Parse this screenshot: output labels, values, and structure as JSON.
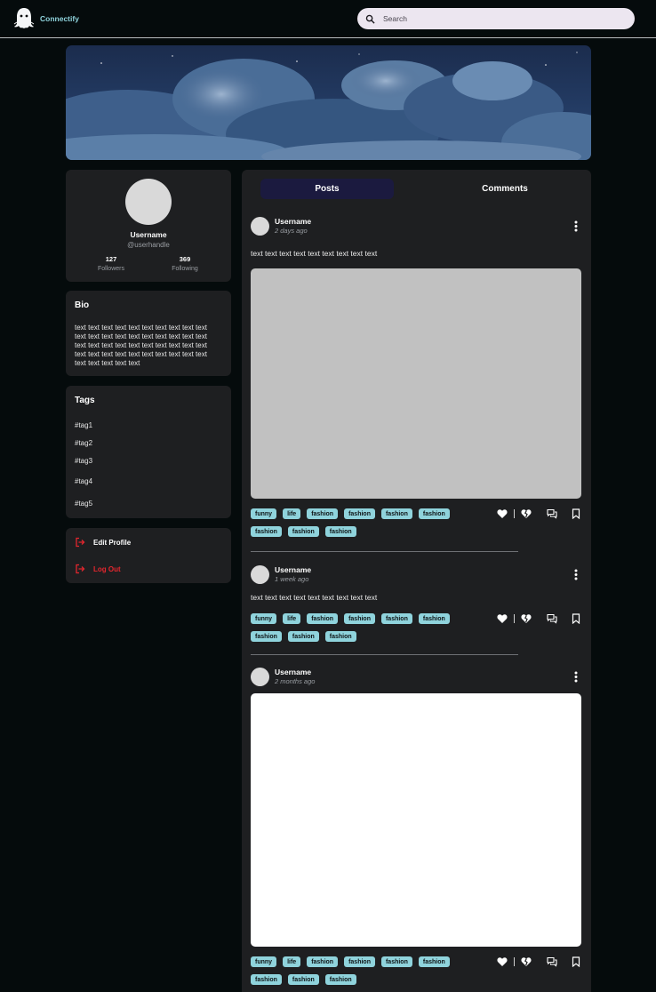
{
  "app": {
    "name": "Connectify"
  },
  "search": {
    "placeholder": "Search"
  },
  "icons": {
    "logo": "ghost-logo-icon",
    "search": "search-icon",
    "edit": "logout-arrow-icon",
    "logout": "logout-arrow-icon",
    "menu": "more-vertical-icon",
    "like": "heart-icon",
    "dislike": "broken-heart-icon",
    "comment": "comments-icon",
    "save": "bookmark-icon"
  },
  "colors": {
    "background": "#050b0c",
    "card": "#1e1f21",
    "brand": "#8fd3dc",
    "tag_chip": "#8fd3dc",
    "active_tab": "#1b1a3f",
    "danger": "#e3262e",
    "search_bg": "#ece6f0"
  },
  "profile": {
    "username": "Username",
    "handle": "@userhandle",
    "followers_count": "127",
    "followers_label": "Followers",
    "following_count": "369",
    "following_label": "Following"
  },
  "bio": {
    "title": "Bio",
    "text": "text text text text text text text text text text text text text text text text text text text text text text text text text text text text text text text text text text text text text text text text text text text text text"
  },
  "tags": {
    "title": "Tags",
    "items": [
      "#tag1",
      "#tag2",
      "#tag3",
      "#tag4",
      "#tag5"
    ]
  },
  "actions": {
    "edit_profile": "Edit Profile",
    "log_out": "Log Out"
  },
  "tabs": {
    "posts": "Posts",
    "comments": "Comments"
  },
  "posts": [
    {
      "username": "Username",
      "time": "2 days ago",
      "text": "text text text text text text text text text",
      "media": "gray-placeholder",
      "tags": [
        "funny",
        "life",
        "fashion",
        "fashion",
        "fashion",
        "fashion",
        "fashion",
        "fashion",
        "fashion"
      ]
    },
    {
      "username": "Username",
      "time": "1 week ago",
      "text": "text text text text text text text text text",
      "tags": [
        "funny",
        "life",
        "fashion",
        "fashion",
        "fashion",
        "fashion",
        "fashion",
        "fashion",
        "fashion"
      ]
    },
    {
      "username": "Username",
      "time": "2 months ago",
      "media": "white-placeholder",
      "tags": [
        "funny",
        "life",
        "fashion",
        "fashion",
        "fashion",
        "fashion",
        "fashion",
        "fashion",
        "fashion"
      ]
    }
  ]
}
